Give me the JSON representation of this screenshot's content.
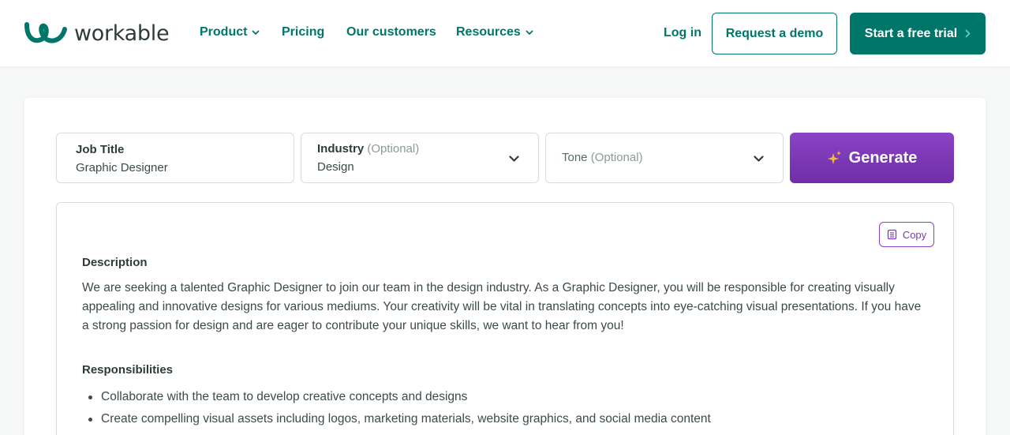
{
  "colors": {
    "brand": "#00756a",
    "generate": "#7b3bb5",
    "text": "#3d4a4a"
  },
  "header": {
    "logo_text": "workable",
    "nav": [
      {
        "label": "Product",
        "has_dropdown": true
      },
      {
        "label": "Pricing",
        "has_dropdown": false
      },
      {
        "label": "Our customers",
        "has_dropdown": false
      },
      {
        "label": "Resources",
        "has_dropdown": true
      }
    ],
    "login_label": "Log in",
    "demo_label": "Request a demo",
    "trial_label": "Start a free trial"
  },
  "form": {
    "job_title": {
      "label": "Job Title",
      "value": "Graphic Designer"
    },
    "industry": {
      "label": "Industry",
      "optional": "(Optional)",
      "value": "Design"
    },
    "tone": {
      "label": "Tone",
      "optional": "(Optional)"
    },
    "generate_label": "Generate"
  },
  "result": {
    "copy_label": "Copy",
    "description_heading": "Description",
    "description_text": "We are seeking a talented Graphic Designer to join our team in the design industry. As a Graphic Designer, you will be responsible for creating visually appealing and innovative designs for various mediums. Your creativity will be vital in translating concepts into eye-catching visual presentations. If you have a strong passion for design and are eager to contribute your unique skills, we want to hear from you!",
    "responsibilities_heading": "Responsibilities",
    "responsibilities": [
      "Collaborate with the team to develop creative concepts and designs",
      "Create compelling visual assets including logos, marketing materials, website graphics, and social media content"
    ]
  }
}
